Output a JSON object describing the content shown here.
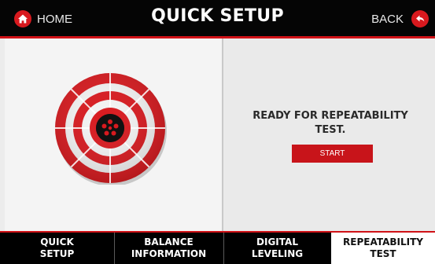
{
  "header": {
    "home_label": "HOME",
    "title": "QUICK SETUP",
    "back_label": "BACK",
    "accent_color": "#d8191e",
    "home_icon": "home-icon",
    "back_icon": "back-arrow-icon"
  },
  "main": {
    "status_text": "READY FOR REPEATABILITY TEST.",
    "start_label": "START",
    "illustration": "target-platform-icon"
  },
  "tabs": [
    {
      "label": "QUICK\nSETUP",
      "active": false
    },
    {
      "label": "BALANCE\nINFORMATION",
      "active": false
    },
    {
      "label": "DIGITAL\nLEVELING",
      "active": false
    },
    {
      "label": "REPEATABILITY\nTEST",
      "active": true
    }
  ]
}
